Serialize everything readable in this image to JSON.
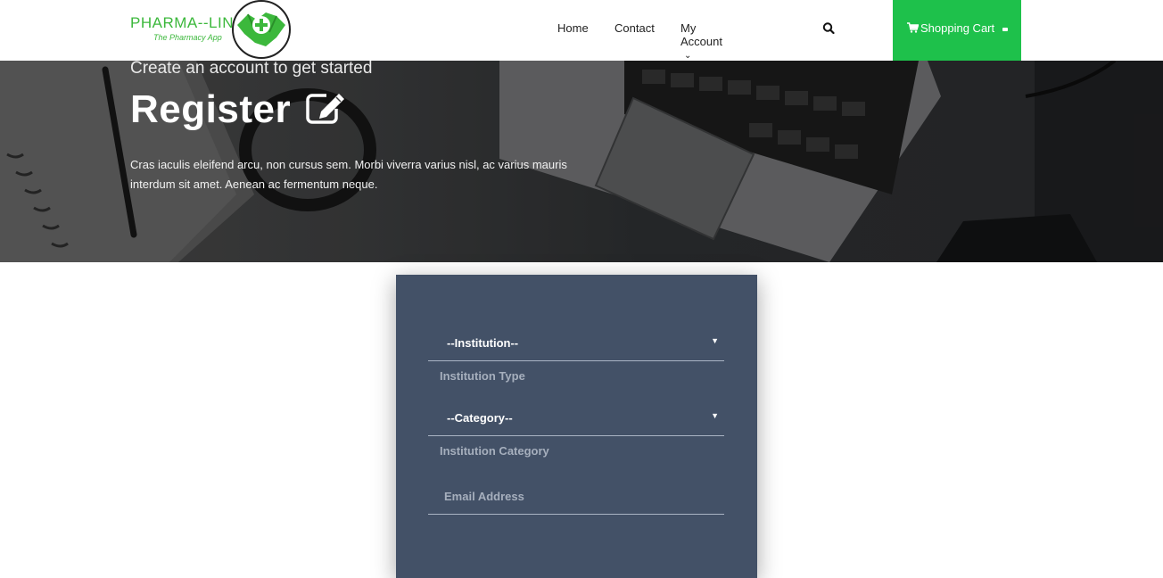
{
  "brand": {
    "name": "PHARMA--LINK",
    "tagline": "The Pharmacy App",
    "accent": "#1ec14b"
  },
  "nav": {
    "items": [
      {
        "label": "Home"
      },
      {
        "label": "Contact"
      },
      {
        "label": "My Account"
      }
    ],
    "search_icon": "search-icon",
    "cart_label": "Shopping Cart",
    "cart_icon": "cart-icon"
  },
  "hero": {
    "subtitle": "Create an account to get started",
    "title": "Register",
    "title_icon": "edit-icon",
    "description": "Cras iaculis eleifend arcu, non cursus sem. Morbi viverra varius nisl, ac varius mauris interdum sit amet. Aenean ac fermentum neque."
  },
  "form": {
    "institution_select": "--Institution--",
    "institution_label": "Institution Type",
    "category_select": "--Category--",
    "category_label": "Institution Category",
    "email_placeholder": "Email Address",
    "card_color": "#435167"
  }
}
